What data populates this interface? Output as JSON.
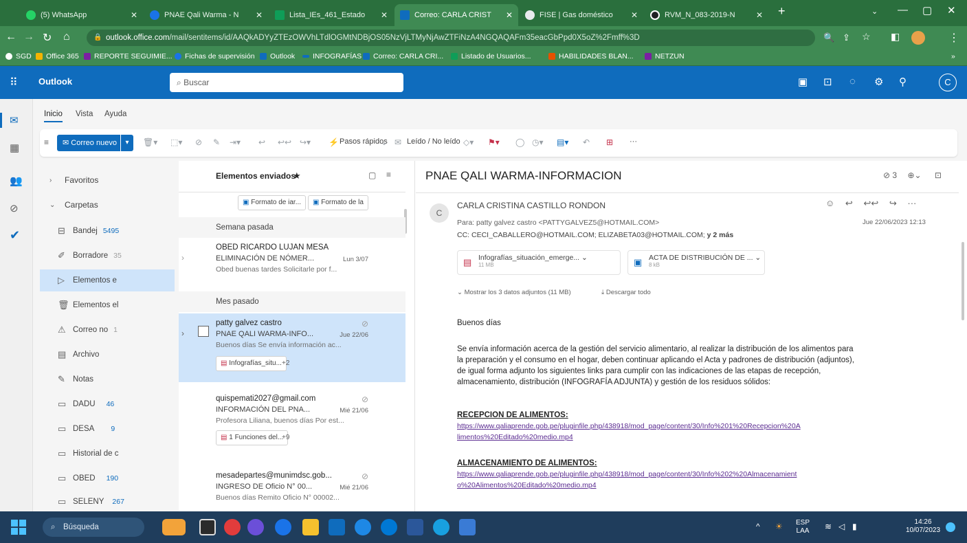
{
  "browser": {
    "tabs": [
      {
        "label": "(5) WhatsApp",
        "color": "#25d366"
      },
      {
        "label": "PNAE Qali Warma - N",
        "color": "#1a73e8"
      },
      {
        "label": "Lista_IEs_461_Estado",
        "color": "#0f9d58"
      },
      {
        "label": "Correo: CARLA CRIST",
        "color": "#0f6cbd",
        "active": true
      },
      {
        "label": "FISE | Gas doméstico",
        "color": "#e8eaed"
      },
      {
        "label": "RVM_N_083-2019-N",
        "color": "#202124"
      }
    ],
    "new_tab": "+",
    "url_host": "outlook.office.com",
    "url_path": "/mail/sentitems/id/AAQkADYyZTEzOWVhLTdlOGMtNDBjOS05NzVjLTMyNjAwZTFiNzA4NGQAQAFm35eacGbPpd0X5oZ%2Fmff%3D",
    "bookmarks": [
      {
        "label": "SGD",
        "color": "#ffffff"
      },
      {
        "label": "Office 365",
        "color": "#f4b400"
      },
      {
        "label": "REPORTE SEGUIMIE...",
        "color": "#7b1fa2"
      },
      {
        "label": "Fichas de supervisión",
        "color": "#1a73e8"
      },
      {
        "label": "Outlook",
        "color": "#0f6cbd"
      },
      {
        "label": "INFOGRAFÍAS",
        "color": "#0f6cbd"
      },
      {
        "label": "Correo: CARLA CRI...",
        "color": "#0f6cbd"
      },
      {
        "label": "Listado de Usuarios...",
        "color": "#0f9d58"
      },
      {
        "label": "HABILIDADES BLAN...",
        "color": "#e65100"
      },
      {
        "label": "NETZUN",
        "color": "#7b1fa2"
      }
    ],
    "more": "»"
  },
  "outlook": {
    "app_name": "Outlook",
    "search_placeholder": "Buscar",
    "avatar_letter": "C",
    "ribbon_tabs": [
      "Inicio",
      "Vista",
      "Ayuda"
    ],
    "new_mail": "Correo nuevo",
    "quick_steps": "Pasos rápidos",
    "read_unread": "Leído / No leído",
    "more": "···",
    "folders": {
      "favorites": "Favoritos",
      "folders_label": "Carpetas",
      "items": [
        {
          "label": "Bandej",
          "count": "5495",
          "icon": "inbox-icon"
        },
        {
          "label": "Borradore",
          "count": "35",
          "icon": "drafts-icon"
        },
        {
          "label": "Elementos e",
          "count": "",
          "icon": "sent-icon",
          "selected": true
        },
        {
          "label": "Elementos el",
          "count": "",
          "icon": "trash-icon"
        },
        {
          "label": "Correo no",
          "count": "1",
          "icon": "junk-icon"
        },
        {
          "label": "Archivo",
          "count": "",
          "icon": "archive-icon"
        },
        {
          "label": "Notas",
          "count": "",
          "icon": "notes-icon"
        },
        {
          "label": "DADU",
          "count": "46",
          "icon": "folder-icon"
        },
        {
          "label": "DESA",
          "count": "9",
          "icon": "folder-icon"
        },
        {
          "label": "Historial de c",
          "count": "",
          "icon": "folder-icon"
        },
        {
          "label": "OBED",
          "count": "190",
          "icon": "folder-icon"
        },
        {
          "label": "SELENY",
          "count": "267",
          "icon": "folder-icon"
        }
      ]
    },
    "list": {
      "title": "Elementos enviados",
      "star": "★",
      "top_chips": [
        "Formato de iar...",
        "Formato de la"
      ],
      "section_week": "Semana pasada",
      "section_month": "Mes pasado",
      "messages": [
        {
          "sender": "OBED RICARDO LUJAN MESA",
          "subject": "ELIMINACIÓN DE NÓMER...",
          "date": "Lun 3/07",
          "preview": "Obed buenas tardes Solicitarle por f..."
        },
        {
          "sender": "patty galvez castro",
          "subject": "PNAE QALI WARMA-INFO...",
          "date": "Jue 22/06",
          "preview": "Buenos días Se envía información ac...",
          "chip": "Infografías_situ...",
          "extra": "+2"
        },
        {
          "sender": "quispemati2027@gmail.com",
          "subject": "INFORMACIÓN DEL PNA...",
          "date": "Mié 21/06",
          "preview": "Profesora Liliana, buenos días Por est...",
          "chip": "1 Funciones del...",
          "extra": "+9"
        },
        {
          "sender": "mesadepartes@munimdsc.gob...",
          "subject": "INGRESO DE Oficio N° 00...",
          "date": "Mié 21/06",
          "preview": "Buenos días Remito Oficio N° 00002..."
        }
      ]
    },
    "reading": {
      "subject": "PNAE QALI WARMA-INFORMACION",
      "sender": "CARLA CRISTINA CASTILLO RONDON",
      "avatar": "C",
      "to": "Para: patty galvez castro <PATTYGALVEZ5@HOTMAIL.COM>",
      "cc": "CC: CECI_CABALLERO@HOTMAIL.COM; ELIZABETA03@HOTMAIL.COM;",
      "cc_more": "y 2 más",
      "date": "Jue 22/06/2023 12:13",
      "attachments": [
        {
          "name": "Infografías_situación_emerge...",
          "size": "11 MB"
        },
        {
          "name": "ACTA DE DISTRIBUCIÓN DE ...",
          "size": "8 kB"
        }
      ],
      "show_all": "Mostrar los 3 datos adjuntos (11 MB)",
      "download_all": "Descargar todo",
      "greeting": "Buenos días",
      "paragraph": [
        "Se envía información acerca de la gestión del servicio alimentario, al realizar la distribución de los alimentos para",
        "la preparación y el consumo en el hogar, deben continuar aplicando el Acta y padrones de distribución (adjuntos),",
        "de igual forma adjunto los siguientes links para cumplir con las indicaciones de las etapas de recepción,",
        "almacenamiento, distribución (INFOGRAFÍA ADJUNTA) y gestión de los residuos sólidos:"
      ],
      "h1": "RECEPCION DE ALIMENTOS:",
      "link1a": "https://www.qaliaprende.gob.pe/pluginfile.php/438918/mod_page/content/30/Info%201%20Recepcion%20A",
      "link1b": "limentos%20Editado%20medio.mp4",
      "h2": "ALMACENAMIENTO DE ALIMENTOS:",
      "link2a": "https://www.qaliaprende.gob.pe/pluginfile.php/438918/mod_page/content/30/Info%202%20Almacenamient",
      "link2b": "o%20Alimentos%20Editado%20medio.mp4",
      "count_badge": "3"
    }
  },
  "taskbar": {
    "search": "Búsqueda",
    "lang1": "ESP",
    "lang2": "LAA",
    "time": "14:26",
    "date": "10/07/2023"
  }
}
